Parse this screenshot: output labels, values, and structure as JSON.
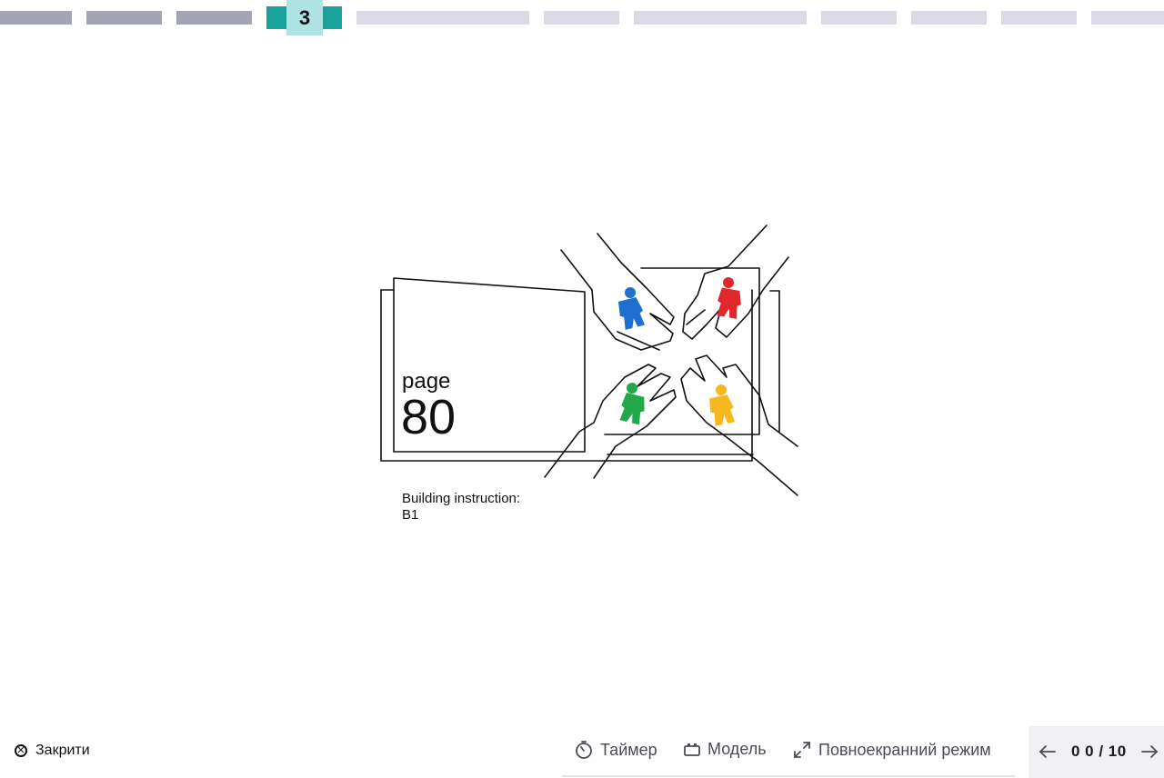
{
  "stepper": {
    "current_step": "3"
  },
  "slide": {
    "page_word": "page",
    "page_number": "80",
    "caption_line1": "Building instruction:",
    "caption_line2": "B1",
    "minifig_colors": {
      "blue": "#1f6fd1",
      "red": "#e0282c",
      "green": "#23a74b",
      "yellow": "#f6b81f"
    }
  },
  "footer": {
    "close_label": "Закрити",
    "timer_label": "Таймер",
    "model_label": "Модель",
    "fullscreen_label": "Повноекранний режим",
    "counter": "0 0 / 10"
  },
  "icons": {
    "close": "close-circle-icon",
    "timer": "timer-icon",
    "model": "brick-icon",
    "fullscreen": "expand-icon",
    "prev": "arrow-left-icon",
    "next": "arrow-right-icon"
  },
  "colors": {
    "accent": "#18a29a",
    "accent_light": "#afe2e3",
    "step_done": "#a3a5b4",
    "step_todo": "#d9dae5"
  }
}
